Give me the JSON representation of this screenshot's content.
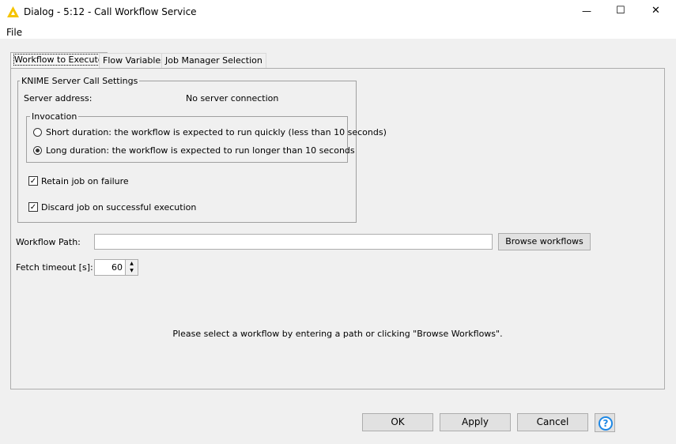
{
  "window": {
    "title": "Dialog - 5:12 - Call Workflow Service",
    "minimize": "—",
    "maximize": "☐",
    "close": "✕"
  },
  "menu": {
    "file": "File"
  },
  "tabs": [
    {
      "label": "Workflow to Execute"
    },
    {
      "label": "Flow Variables"
    },
    {
      "label": "Job Manager Selection"
    }
  ],
  "settings": {
    "legend": "KNIME Server Call Settings",
    "server_label": "Server address:",
    "server_value": "No server connection",
    "invocation": {
      "legend": "Invocation",
      "short": "Short duration: the workflow is expected to run quickly (less than 10 seconds)",
      "long": "Long duration: the workflow is expected to run longer than 10 seconds",
      "selected": "long"
    },
    "retain": {
      "label": "Retain job on failure",
      "checked": true
    },
    "discard": {
      "label": "Discard job on successful execution",
      "checked": true
    }
  },
  "workflow_path": {
    "label": "Workflow Path:",
    "value": "",
    "browse": "Browse workflows"
  },
  "fetch_timeout": {
    "label": "Fetch timeout [s]:",
    "value": "60"
  },
  "message": "Please select a workflow by entering a path or clicking \"Browse Workflows\".",
  "buttons": {
    "ok": "OK",
    "apply": "Apply",
    "cancel": "Cancel",
    "help": "?"
  },
  "colors": {
    "knime_logo": "#f5c400",
    "help": "#1e88e5"
  }
}
